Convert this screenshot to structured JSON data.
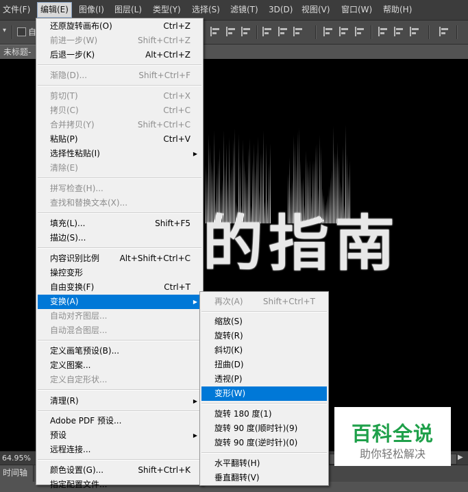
{
  "menubar": {
    "items": [
      "文件(F)",
      "编辑(E)",
      "图像(I)",
      "图层(L)",
      "类型(Y)",
      "选择(S)",
      "滤镜(T)",
      "3D(D)",
      "视图(V)",
      "窗口(W)",
      "帮助(H)"
    ]
  },
  "optionsbar": {
    "partial_label": "自"
  },
  "document": {
    "tab_title": "未标题-"
  },
  "status": {
    "zoom": "64.95%"
  },
  "timeline": {
    "label": "时间轴"
  },
  "edit_menu": {
    "items": [
      {
        "label": "还原旋转画布(O)",
        "shortcut": "Ctrl+Z"
      },
      {
        "label": "前进一步(W)",
        "shortcut": "Shift+Ctrl+Z"
      },
      {
        "label": "后退一步(K)",
        "shortcut": "Alt+Ctrl+Z"
      },
      {
        "label": "渐隐(D)...",
        "shortcut": "Shift+Ctrl+F"
      },
      {
        "label": "剪切(T)",
        "shortcut": "Ctrl+X"
      },
      {
        "label": "拷贝(C)",
        "shortcut": "Ctrl+C"
      },
      {
        "label": "合并拷贝(Y)",
        "shortcut": "Shift+Ctrl+C"
      },
      {
        "label": "粘贴(P)",
        "shortcut": "Ctrl+V"
      },
      {
        "label": "选择性粘贴(I)",
        "shortcut": ""
      },
      {
        "label": "清除(E)",
        "shortcut": ""
      },
      {
        "label": "拼写检查(H)...",
        "shortcut": ""
      },
      {
        "label": "查找和替换文本(X)...",
        "shortcut": ""
      },
      {
        "label": "填充(L)...",
        "shortcut": "Shift+F5"
      },
      {
        "label": "描边(S)...",
        "shortcut": ""
      },
      {
        "label": "内容识别比例",
        "shortcut": "Alt+Shift+Ctrl+C"
      },
      {
        "label": "操控变形",
        "shortcut": ""
      },
      {
        "label": "自由变换(F)",
        "shortcut": "Ctrl+T"
      },
      {
        "label": "变换(A)",
        "shortcut": ""
      },
      {
        "label": "自动对齐图层...",
        "shortcut": ""
      },
      {
        "label": "自动混合图层...",
        "shortcut": ""
      },
      {
        "label": "定义画笔预设(B)...",
        "shortcut": ""
      },
      {
        "label": "定义图案...",
        "shortcut": ""
      },
      {
        "label": "定义自定形状...",
        "shortcut": ""
      },
      {
        "label": "清理(R)",
        "shortcut": ""
      },
      {
        "label": "Adobe PDF 预设...",
        "shortcut": ""
      },
      {
        "label": "预设",
        "shortcut": ""
      },
      {
        "label": "远程连接...",
        "shortcut": ""
      },
      {
        "label": "颜色设置(G)...",
        "shortcut": "Shift+Ctrl+K"
      },
      {
        "label": "指定配置文件...",
        "shortcut": ""
      }
    ]
  },
  "transform_menu": {
    "items": [
      {
        "label": "再次(A)",
        "shortcut": "Shift+Ctrl+T"
      },
      {
        "label": "缩放(S)",
        "shortcut": ""
      },
      {
        "label": "旋转(R)",
        "shortcut": ""
      },
      {
        "label": "斜切(K)",
        "shortcut": ""
      },
      {
        "label": "扭曲(D)",
        "shortcut": ""
      },
      {
        "label": "透视(P)",
        "shortcut": ""
      },
      {
        "label": "变形(W)",
        "shortcut": ""
      },
      {
        "label": "旋转 180 度(1)",
        "shortcut": ""
      },
      {
        "label": "旋转 90 度(顺时针)(9)",
        "shortcut": ""
      },
      {
        "label": "旋转 90 度(逆时针)(0)",
        "shortcut": ""
      },
      {
        "label": "水平翻转(H)",
        "shortcut": ""
      },
      {
        "label": "垂直翻转(V)",
        "shortcut": ""
      }
    ]
  },
  "canvas_text": {
    "chars": [
      "的",
      "指",
      "南"
    ]
  },
  "watermark": {
    "title": "百科全说",
    "subtitle": "助你轻松解决"
  },
  "colors": {
    "highlight": "#0078d7",
    "watermark_green": "#1fa04a",
    "menubar_bg": "#3c3c3c"
  }
}
